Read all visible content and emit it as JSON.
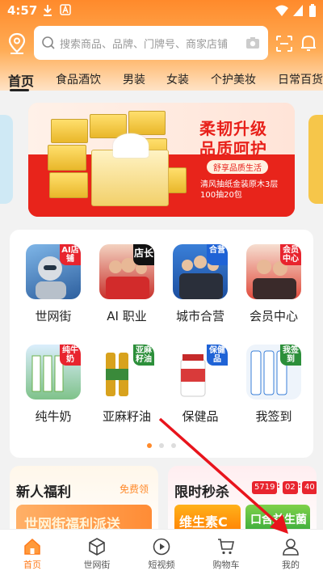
{
  "status_bar": {
    "time": "4:57"
  },
  "search": {
    "placeholder": "搜索商品、品牌、门牌号、商家店铺"
  },
  "tabs": [
    "首页",
    "食品酒饮",
    "男装",
    "女装",
    "个护美妆",
    "日常百货"
  ],
  "banner": {
    "headline1": "柔韧升级",
    "headline2": "品质呵护",
    "tagline": "舒享品质生活",
    "product_line1": "清风抽纸金装原木3层",
    "product_line2": "100抽20包"
  },
  "categories": [
    {
      "label": "世网街",
      "tag": "AI店铺",
      "icon": "ai-robot-icon"
    },
    {
      "label": "AI 职业",
      "tag": "店长",
      "icon": "staff-photo-icon"
    },
    {
      "label": "城市合营",
      "tag": "合营",
      "icon": "business-team-icon"
    },
    {
      "label": "会员中心",
      "tag": "会员中心",
      "icon": "member-photo-icon"
    },
    {
      "label": "纯牛奶",
      "tag": "纯牛奶",
      "icon": "milk-icon"
    },
    {
      "label": "亚麻籽油",
      "tag": "亚麻籽油",
      "icon": "oil-bottle-icon"
    },
    {
      "label": "保健品",
      "tag": "保健品",
      "icon": "supplement-bottle-icon"
    },
    {
      "label": "我签到",
      "tag": "我签到",
      "icon": "check-in-icon"
    }
  ],
  "carousel": {
    "active_index": 0,
    "count": 3
  },
  "promo_left": {
    "title": "新人福利",
    "link": "免费领",
    "strip_text": "世网街福利派送"
  },
  "promo_right": {
    "title": "限时秒杀",
    "countdown": [
      "5719",
      "02",
      "40"
    ],
    "items": [
      "维生素C",
      "口含益生菌"
    ]
  },
  "bottom_nav": [
    {
      "label": "首页",
      "icon": "home-icon",
      "active": true
    },
    {
      "label": "世网街",
      "icon": "cube-icon",
      "active": false
    },
    {
      "label": "短视频",
      "icon": "play-circle-icon",
      "active": false
    },
    {
      "label": "购物车",
      "icon": "cart-icon",
      "active": false
    },
    {
      "label": "我的",
      "icon": "person-icon",
      "active": false
    }
  ],
  "colors": {
    "accent": "#ff8a2b",
    "banner_red": "#e8241b",
    "countdown_red": "#e8242e"
  }
}
